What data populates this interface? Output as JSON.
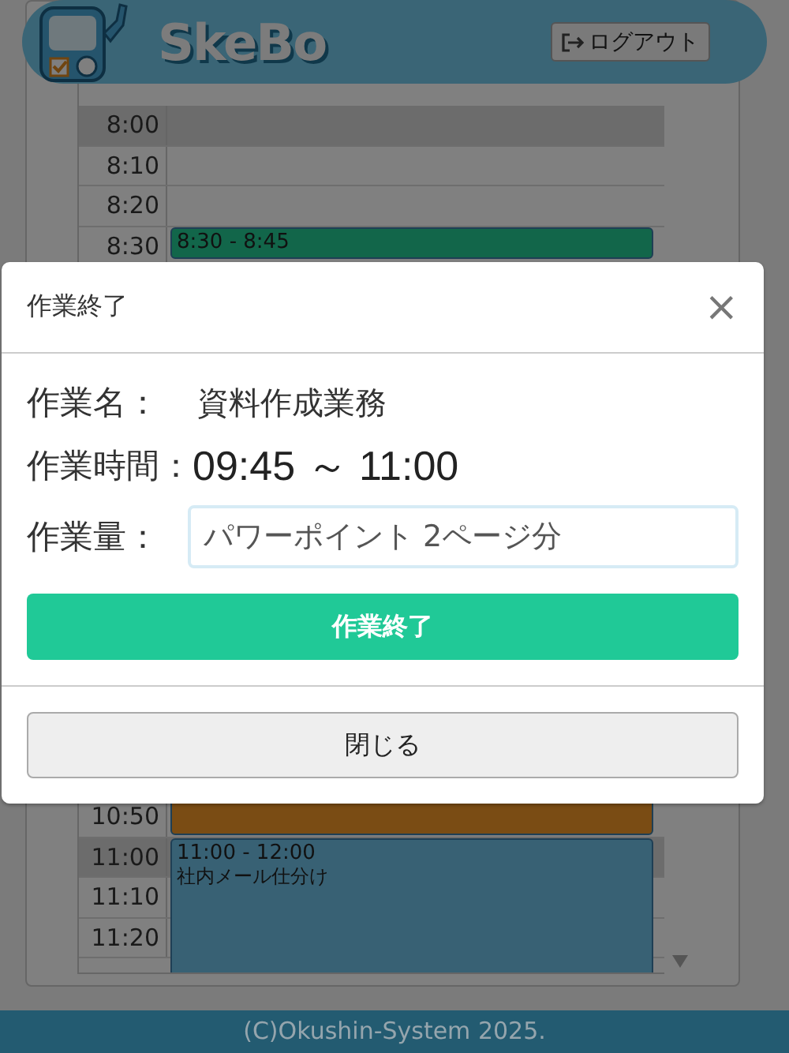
{
  "header": {
    "logo_text": "SkeBo",
    "logout_button": "ログアウト"
  },
  "schedule": {
    "top_rows": [
      {
        "time": "8:00",
        "highlighted": true
      },
      {
        "time": "8:10",
        "highlighted": false
      },
      {
        "time": "8:20",
        "highlighted": false
      },
      {
        "time": "8:30",
        "highlighted": false,
        "event": {
          "kind": "start",
          "color": "#12664a",
          "time_range": "8:30 - 8:45"
        }
      }
    ],
    "bottom_rows": [
      {
        "time": "10:50",
        "highlighted": false,
        "event": {
          "kind": "end",
          "color": "#7a4c14"
        }
      },
      {
        "time": "11:00",
        "highlighted": true,
        "event": {
          "kind": "start",
          "color": "#386174",
          "time_range": "11:00 - 12:00",
          "title": "社内メール仕分け"
        }
      },
      {
        "time": "11:10",
        "highlighted": false
      },
      {
        "time": "11:20",
        "highlighted": false
      }
    ]
  },
  "modal": {
    "title": "作業終了",
    "close_icon": "×",
    "fields": [
      {
        "kind": "text",
        "label": "作業名：",
        "value": "資料作成業務"
      },
      {
        "kind": "time",
        "label": "作業時間：",
        "value": "09:45 ～ 11:00"
      },
      {
        "kind": "input",
        "label": "作業量：",
        "value": "パワーポイント 2ページ分"
      }
    ],
    "submit_button": "作業終了",
    "close_button": "閉じる"
  },
  "footer": {
    "copyright": "(C)Okushin-System 2025."
  }
}
